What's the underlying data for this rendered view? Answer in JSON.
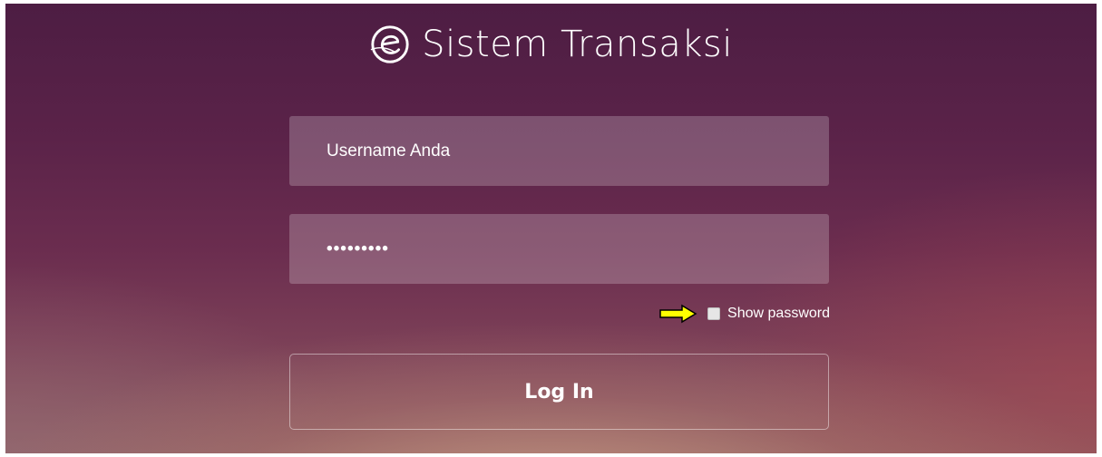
{
  "app": {
    "title": "Sistem Transaksi",
    "logo_icon": "e-logo-icon"
  },
  "form": {
    "username_value": "Username Anda",
    "password_value": "•••••••••",
    "show_password_label": "Show password",
    "show_password_checked": false,
    "login_label": "Log In"
  },
  "annotation": {
    "arrow_icon": "yellow-arrow-icon",
    "arrow_color": "#ffff00"
  }
}
